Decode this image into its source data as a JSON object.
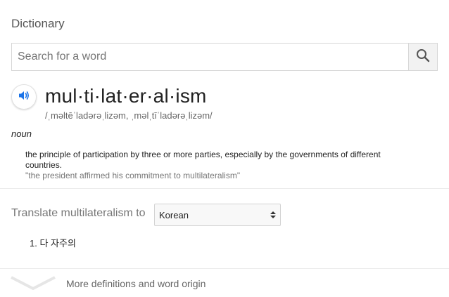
{
  "panel": {
    "title": "Dictionary"
  },
  "search": {
    "placeholder": "Search for a word",
    "value": ""
  },
  "entry": {
    "headword": "mul·ti·lat·er·al·ism",
    "phonetic": "/ˌməltēˈladərəˌlizəm, ˌməlˌtīˈladərəˌlizəm/",
    "part_of_speech": "noun",
    "definition": "the principle of participation by three or more parties, especially by the governments of different countries.",
    "example": "\"the president affirmed his commitment to multilateralism\""
  },
  "translate": {
    "label": "Translate multilateralism to",
    "selected_language": "Korean",
    "results": [
      "1. 다 자주의"
    ]
  },
  "footer": {
    "more_label": "More definitions and word origin"
  },
  "icons": {
    "search": "search-icon",
    "audio": "speaker-icon",
    "expand": "chevron-down-icon",
    "select_arrows": "select-arrows-icon"
  },
  "colors": {
    "accent_blue": "#1a73e8",
    "muted_text": "#777777"
  }
}
